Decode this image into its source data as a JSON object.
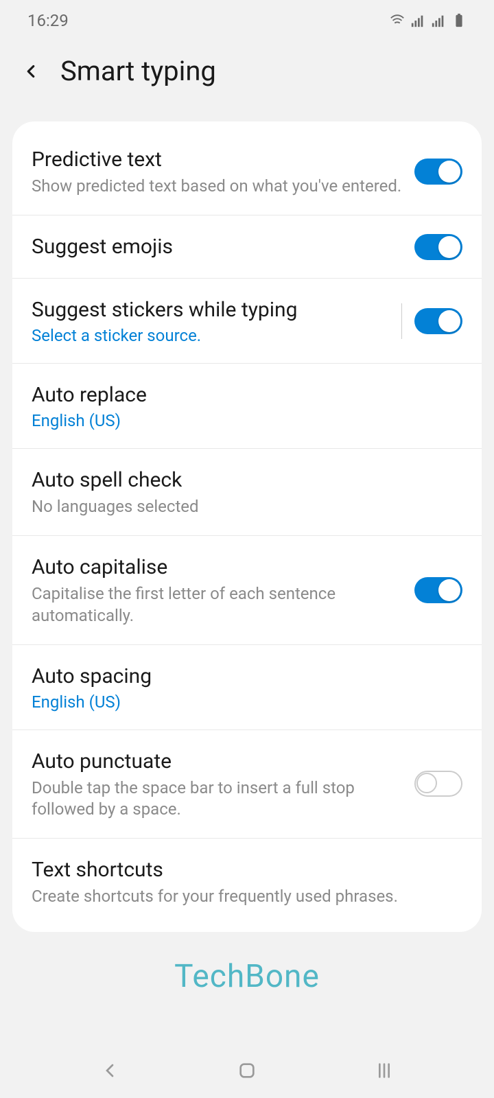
{
  "status": {
    "time": "16:29"
  },
  "header": {
    "title": "Smart typing"
  },
  "rows": {
    "predictive": {
      "title": "Predictive text",
      "sub": "Show predicted text based on what you've entered."
    },
    "emojis": {
      "title": "Suggest emojis"
    },
    "stickers": {
      "title": "Suggest stickers while typing",
      "link": "Select a sticker source."
    },
    "autoreplace": {
      "title": "Auto replace",
      "link": "English (US)"
    },
    "spellcheck": {
      "title": "Auto spell check",
      "sub": "No languages selected"
    },
    "capitalise": {
      "title": "Auto capitalise",
      "sub": "Capitalise the first letter of each sentence automatically."
    },
    "spacing": {
      "title": "Auto spacing",
      "link": "English (US)"
    },
    "punctuate": {
      "title": "Auto punctuate",
      "sub": "Double tap the space bar to insert a full stop followed by a space."
    },
    "shortcuts": {
      "title": "Text shortcuts",
      "sub": "Create shortcuts for your frequently used phrases."
    }
  },
  "watermark": "TechBone"
}
